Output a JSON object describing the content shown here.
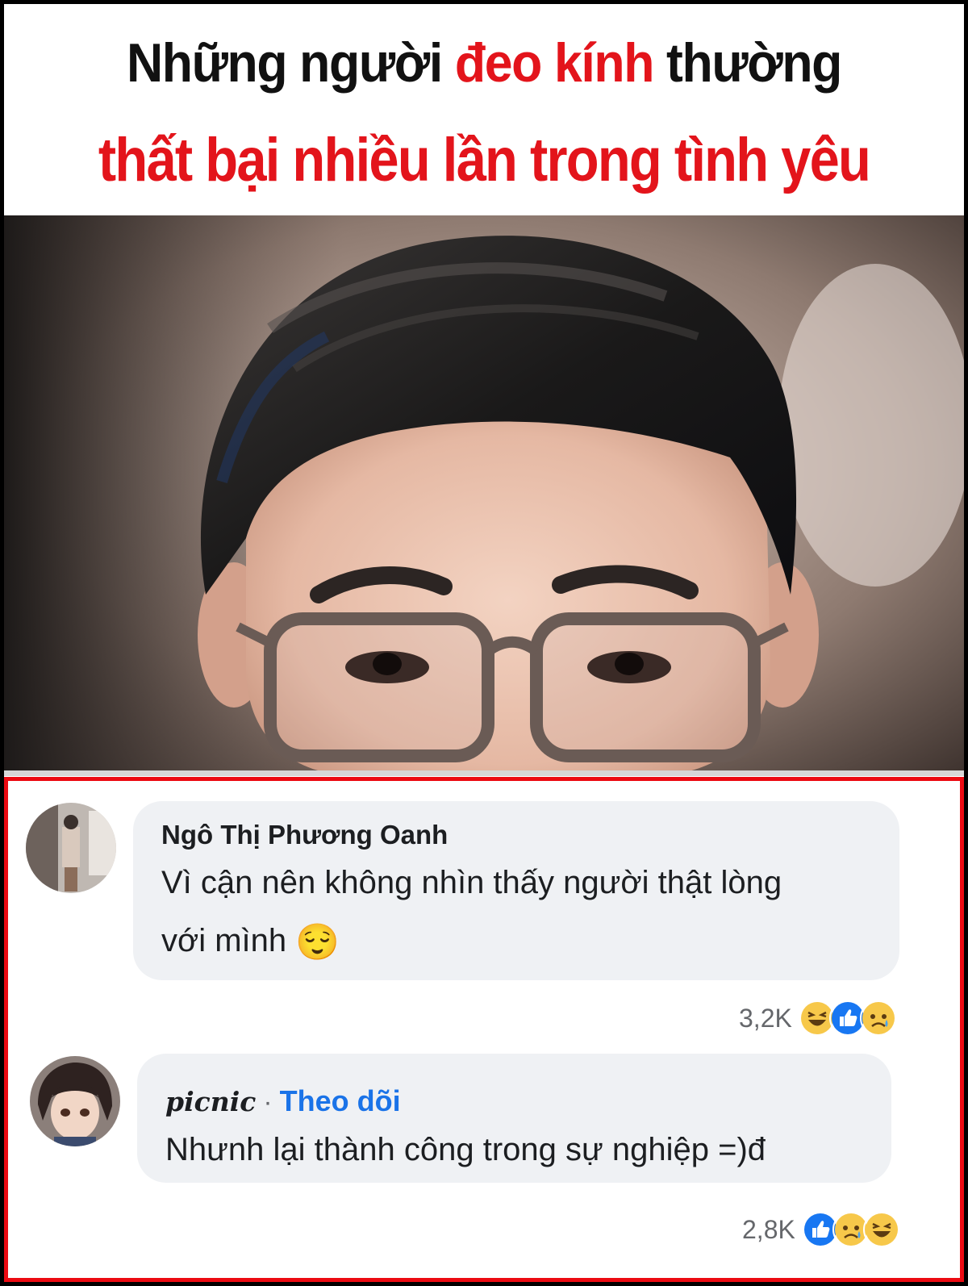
{
  "headline": {
    "line1_part1": "Những người ",
    "line1_part2": "đeo kính",
    "line1_part3": " thường",
    "line2": "thất bại nhiều lần trong tình yêu"
  },
  "comments": [
    {
      "author": "Ngô Thị Phương Oanh",
      "text_line1": "Vì cận nên không nhìn thấy người thật lòng",
      "text_line2": "với mình",
      "emoji": "😌",
      "reaction_count": "3,2K",
      "reactions": [
        "haha-icon",
        "like-icon",
        "sad-icon"
      ]
    },
    {
      "author": "picnic",
      "separator": "·",
      "follow_label": "Theo dõi",
      "text_line1": "Nhưnh lại thành công trong sự nghiệp =)đ",
      "reaction_count": "2,8K",
      "reactions": [
        "like-icon",
        "sad-icon",
        "haha-icon"
      ]
    }
  ],
  "colors": {
    "headline_red": "#e3141b",
    "frame_red": "#ec0a12",
    "link_blue": "#1a73e8",
    "bubble_gray": "#eff1f4"
  }
}
